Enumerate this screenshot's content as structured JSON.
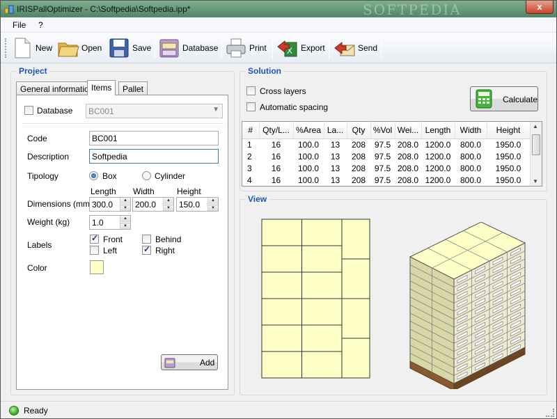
{
  "window": {
    "title": "IRISPallOptimizer - C:\\Softpedia\\Softpedia.ipp*",
    "watermark": "SOFTPEDIA",
    "close_glyph": "x"
  },
  "menu": {
    "file": "File",
    "help": "?"
  },
  "toolbar": {
    "new": "New",
    "open": "Open",
    "save": "Save",
    "database": "Database",
    "print": "Print",
    "export": "Export",
    "send": "Send"
  },
  "project": {
    "title": "Project",
    "tabs": [
      "General information",
      "Items",
      "Pallet"
    ],
    "database_label": "Database",
    "database_checked": false,
    "database_value": "BC001",
    "code_label": "Code",
    "code_value": "BC001",
    "description_label": "Description",
    "description_value": "Softpedia",
    "tipology_label": "Tipology",
    "tipology_box": "Box",
    "tipology_cylinder": "Cylinder",
    "tipology_selected": "Box",
    "dimensions_label": "Dimensions (mm)",
    "length_label": "Length",
    "width_label": "Width",
    "height_label": "Height",
    "length_value": "300.0",
    "width_value": "200.0",
    "height_value": "150.0",
    "weight_label": "Weight (kg)",
    "weight_value": "1.0",
    "labels_label": "Labels",
    "label_front": "Front",
    "label_behind": "Behind",
    "label_left": "Left",
    "label_right": "Right",
    "front_checked": true,
    "behind_checked": false,
    "left_checked": false,
    "right_checked": true,
    "color_label": "Color",
    "color_value": "#ffffc8",
    "add_button": "Add"
  },
  "solution": {
    "title": "Solution",
    "cross_layers": "Cross layers",
    "automatic_spacing": "Automatic spacing",
    "calculate": "Calculate",
    "columns": [
      "#",
      "Qty/L...",
      "%Area",
      "La...",
      "Qty",
      "%Vol",
      "Wei...",
      "Length",
      "Width",
      "Height"
    ],
    "rows": [
      [
        "1",
        "16",
        "100.0",
        "13",
        "208",
        "97.5",
        "208.0",
        "1200.0",
        "800.0",
        "1950.0"
      ],
      [
        "2",
        "16",
        "100.0",
        "13",
        "208",
        "97.5",
        "208.0",
        "1200.0",
        "800.0",
        "1950.0"
      ],
      [
        "3",
        "16",
        "100.0",
        "13",
        "208",
        "97.5",
        "208.0",
        "1200.0",
        "800.0",
        "1950.0"
      ],
      [
        "4",
        "16",
        "100.0",
        "13",
        "208",
        "97.5",
        "208.0",
        "1200.0",
        "800.0",
        "1950.0"
      ]
    ]
  },
  "view": {
    "title": "View",
    "box_color": "#ffffc8"
  },
  "status": {
    "text": "Ready"
  },
  "colors": {
    "group_title": "#1b56b5",
    "titlebar": "#5f9276",
    "close": "#c6442c"
  }
}
